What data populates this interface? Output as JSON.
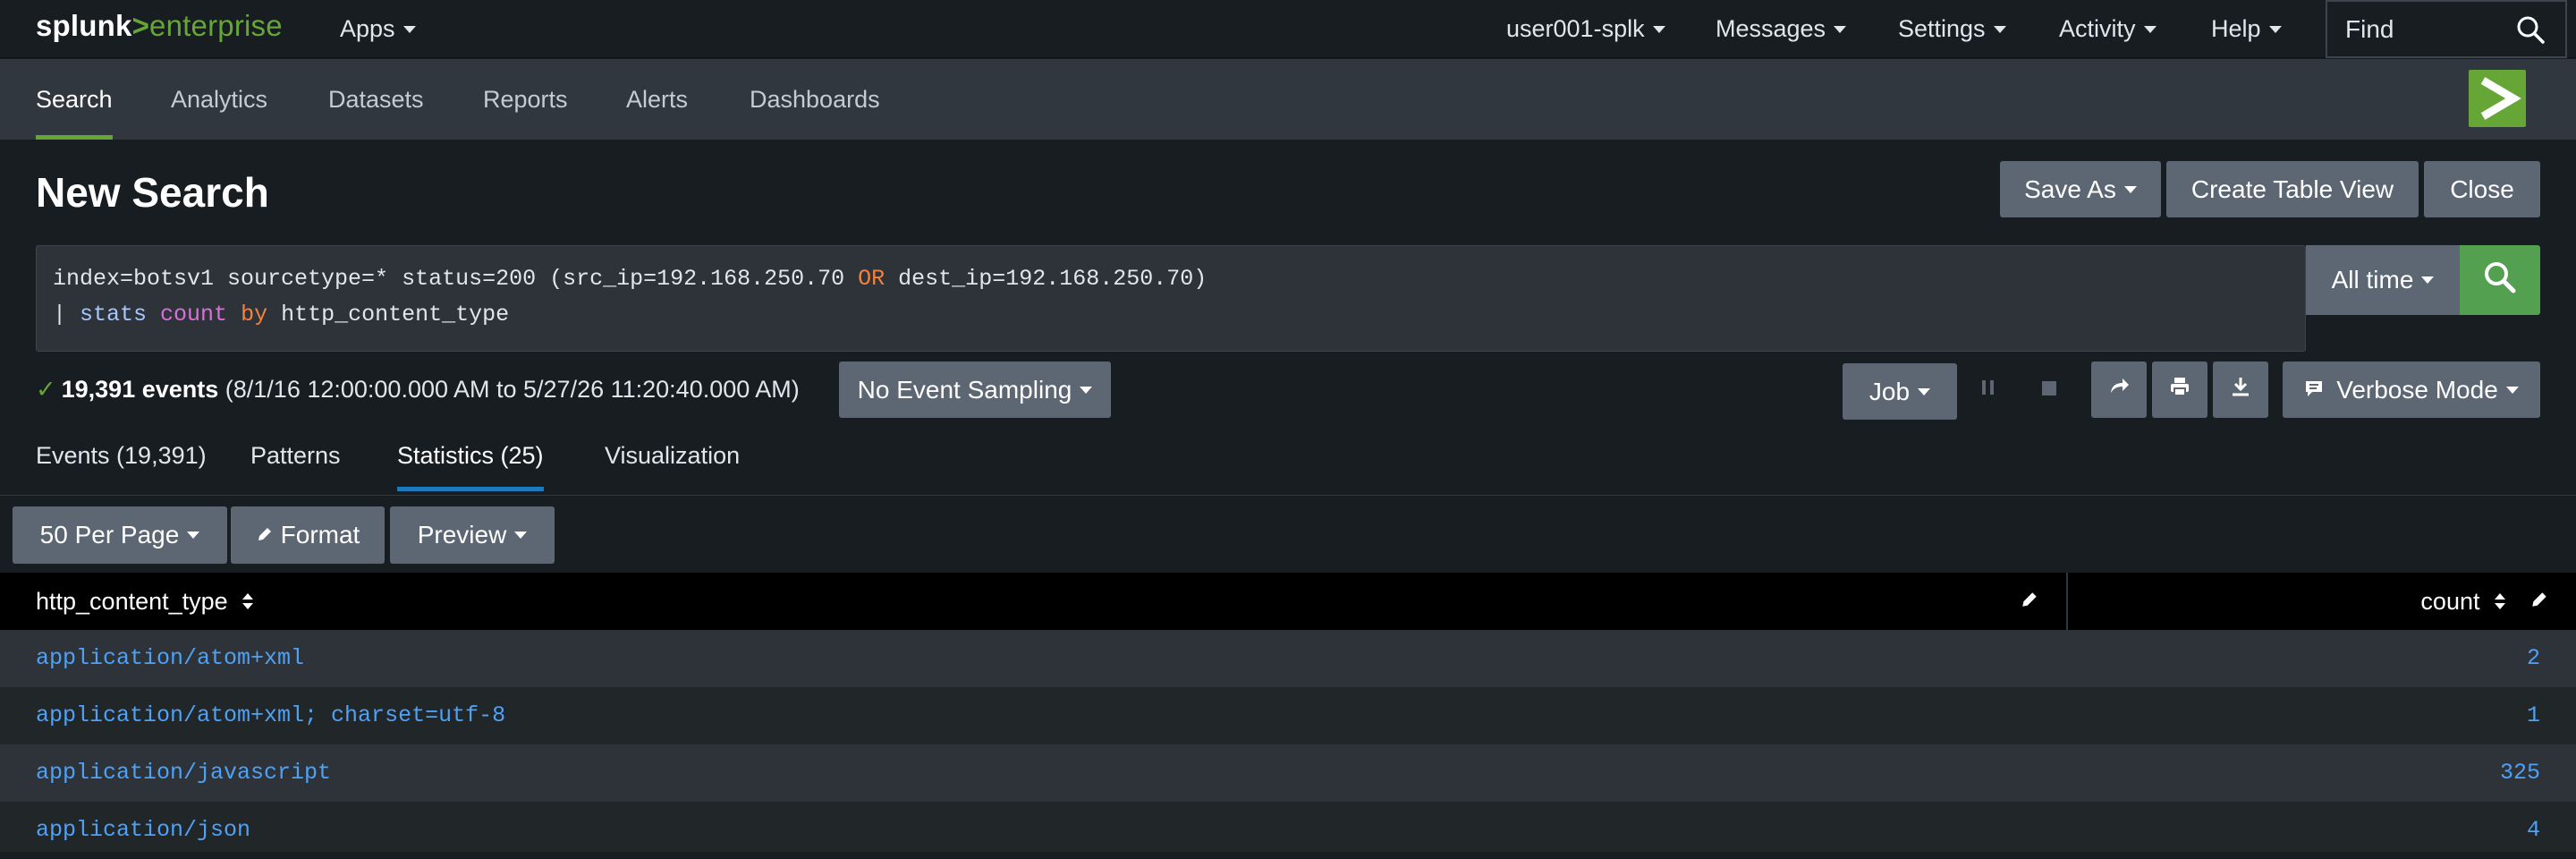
{
  "topbar": {
    "logo_splunk": "splunk",
    "logo_gt": ">",
    "logo_enterprise": "enterprise",
    "apps_label": "Apps",
    "user_label": "user001-splk",
    "messages_label": "Messages",
    "settings_label": "Settings",
    "activity_label": "Activity",
    "help_label": "Help",
    "find_placeholder": "Find"
  },
  "appbar": {
    "tabs": [
      {
        "label": "Search",
        "active": true
      },
      {
        "label": "Analytics"
      },
      {
        "label": "Datasets"
      },
      {
        "label": "Reports"
      },
      {
        "label": "Alerts"
      },
      {
        "label": "Dashboards"
      }
    ]
  },
  "page": {
    "title": "New Search",
    "save_as": "Save As",
    "create_table_view": "Create Table View",
    "close": "Close"
  },
  "search": {
    "line1_a": "index=botsv1 sourcetype=* status=200 (src_ip=192.168.250.70 ",
    "line1_or": "OR",
    "line1_b": " dest_ip=192.168.250.70)",
    "line2_pipe": "| ",
    "line2_cmd": "stats",
    "line2_fn": "count",
    "line2_by": "by",
    "line2_field": "http_content_type",
    "time_range": "All time"
  },
  "status": {
    "check": "✓",
    "events": "19,391 events",
    "range": "(8/1/16 12:00:00.000 AM to 5/27/26 11:20:40.000 AM)",
    "sampling": "No Event Sampling",
    "job": "Job",
    "mode": "Verbose Mode"
  },
  "result_tabs": [
    {
      "label": "Events (19,391)"
    },
    {
      "label": "Patterns"
    },
    {
      "label": "Statistics (25)",
      "active": true
    },
    {
      "label": "Visualization"
    }
  ],
  "table_controls": {
    "per_page": "50 Per Page",
    "format": "Format",
    "preview": "Preview"
  },
  "table": {
    "columns": [
      "http_content_type",
      "count"
    ],
    "rows": [
      {
        "http_content_type": "application/atom+xml",
        "count": "2"
      },
      {
        "http_content_type": "application/atom+xml; charset=utf-8",
        "count": "1"
      },
      {
        "http_content_type": "application/javascript",
        "count": "325"
      },
      {
        "http_content_type": "application/json",
        "count": "4"
      }
    ]
  },
  "colors": {
    "accent_green": "#65a637",
    "link_blue": "#4fa1f5",
    "active_tab_blue": "#1a7bbf"
  },
  "icons": {
    "find": "search-icon",
    "go": "search-icon",
    "pause": "pause-icon",
    "stop": "stop-icon",
    "share": "share-icon",
    "print": "print-icon",
    "export": "download-icon",
    "mode": "comment-icon",
    "sort": "sort-icon",
    "edit": "pencil-icon",
    "check": "check-icon"
  }
}
